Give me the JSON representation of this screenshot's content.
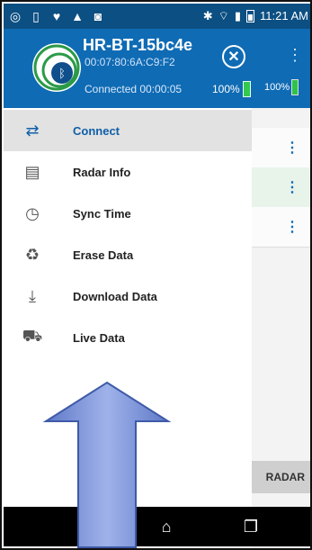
{
  "status_bar": {
    "left_icons": [
      "notification-icon",
      "cast-icon",
      "twitter-icon",
      "warning-icon",
      "image-icon"
    ],
    "time": "11:21 AM"
  },
  "drawer": {
    "device_name": "HR-BT-15bc4e",
    "mac": "00:07:80:6A:C9:F2",
    "connection_status": "Connected 00:00:05",
    "battery_percent": "100%",
    "menu_items": [
      {
        "label": "Connect",
        "icon": "connect-icon"
      },
      {
        "label": "Radar Info",
        "icon": "clipboard-icon"
      },
      {
        "label": "Sync Time",
        "icon": "clock-icon"
      },
      {
        "label": "Erase Data",
        "icon": "recycle-icon"
      },
      {
        "label": "Download Data",
        "icon": "download-icon"
      },
      {
        "label": "Live Data",
        "icon": "car-radar-icon"
      }
    ]
  },
  "background_app": {
    "battery_percent": "100%",
    "bottom_button": "RADAR"
  },
  "colors": {
    "primary": "#0f6bb4",
    "status_bar": "#0c4f82",
    "active_item_bg": "#e2e2e2",
    "battery_green": "#35c84f"
  }
}
